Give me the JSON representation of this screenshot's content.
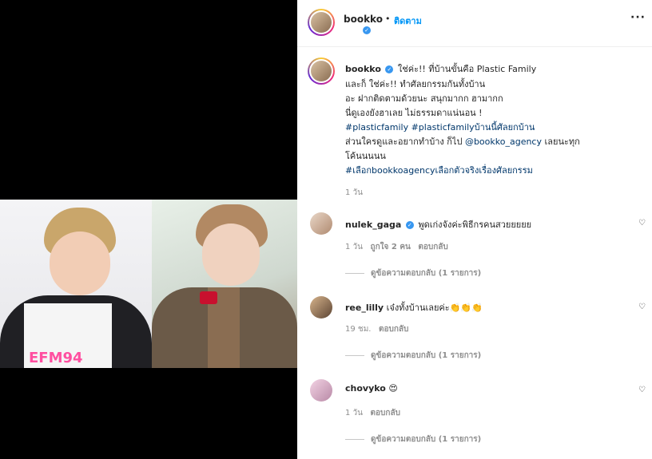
{
  "post": {
    "username": "bookko",
    "follow_label": "ติดตาม",
    "more_icon": "ellipsis-icon",
    "caption_lines": [
      "ใช่ค่ะ!! ที่บ้านขั้นคือ Plastic Family",
      "และก็ ใช่ค่ะ!! ทำศัลยกรรมกันทั้งบ้าน",
      "อะ ฝากติดตามด้วยนะ สนุกมากก ฮามากก",
      "นี่ดูเองยังฮาเลย ไม่ธรรมดาแน่นอน !"
    ],
    "hashtags_line": "#plasticfamily #plasticfamilyบ้านนี้ศัลยกบ้าน",
    "caption_line6_prefix": "ส่วนใครดูและอยากทำบ้าง ก็ไป",
    "mention": "@bookko_agency",
    "caption_line6_suffix": "เลยนะทุก",
    "caption_line7": "โค้นนนนน",
    "hashtag_last": "#เลือกbookkoagencyเลือกตัวจริงเรื่องศัลยกรรม",
    "time_ago": "1 วัน",
    "photo_caption_text": "EFM94"
  },
  "comments": [
    {
      "username": "nulek_gaga",
      "verified": true,
      "text": "พูดเก่งจังค่ะพิธีกรคนสวยยยยย",
      "time": "1 วัน",
      "likes": "ถูกใจ 2 คน",
      "reply_label": "ตอบกลับ",
      "view_replies": "ดูข้อความตอบกลับ (1 รายการ)"
    },
    {
      "username": "ree_lilly",
      "verified": false,
      "text": "เจ๋งทั้งบ้านเลยค่ะ👏👏👏",
      "time": "19 ชม.",
      "likes": "",
      "reply_label": "ตอบกลับ",
      "view_replies": "ดูข้อความตอบกลับ (1 รายการ)"
    },
    {
      "username": "chovyko",
      "verified": false,
      "text": "😍",
      "time": "1 วัน",
      "likes": "",
      "reply_label": "ตอบกลับ",
      "view_replies": "ดูข้อความตอบกลับ (1 รายการ)"
    }
  ],
  "icons": {
    "verified": "verified-badge-icon",
    "heart": "heart-icon"
  },
  "colors": {
    "link": "#00376b",
    "follow": "#0095f6",
    "verified": "#3897f0",
    "muted": "#8e8e8e"
  }
}
